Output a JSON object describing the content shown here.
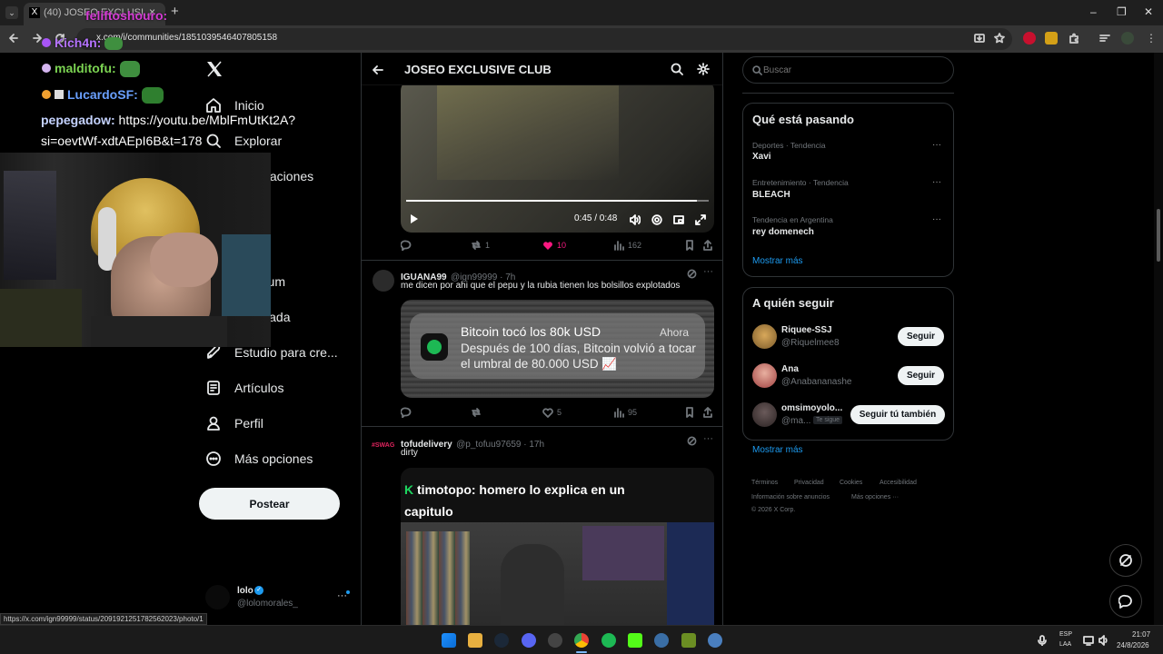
{
  "browser": {
    "tab_title": "(40) JOSEO EXCLUSI...",
    "tab_close": "×",
    "new_tab": "+",
    "url": "x.com/i/communities/1851039546407805158",
    "status_url": "https://x.com/ign99999/status/2091921251782562023/photo/1",
    "window_controls": [
      "–",
      "❐",
      "✕"
    ]
  },
  "sidebar": {
    "items": [
      {
        "label": "Inicio",
        "icon": "home-icon"
      },
      {
        "label": "Explorar",
        "icon": "search-icon"
      },
      {
        "label": "Notificaciones",
        "icon": "bell-icon"
      },
      {
        "label": "Premium",
        "icon": "x-icon"
      },
      {
        "label": "Verificada",
        "icon": "lightning-icon"
      },
      {
        "label": "Estudio para cre...",
        "icon": "rocket-icon"
      },
      {
        "label": "Artículos",
        "icon": "article-icon"
      },
      {
        "label": "Perfil",
        "icon": "person-icon"
      },
      {
        "label": "Más opciones",
        "icon": "more-circle-icon"
      }
    ],
    "post_button": "Postear",
    "account": {
      "name": "lolo",
      "handle": "@lolomorales_"
    }
  },
  "main": {
    "header_title": "JOSEO EXCLUSIVE CLUB",
    "video": {
      "time": "0:45 / 0:48",
      "progress": 0.96
    },
    "tweet1_actions": {
      "replies": "",
      "reposts": "1",
      "likes": "10",
      "views": "162"
    },
    "tweet2": {
      "name": "IGUANA99",
      "handle": "@ign99999 · 7h",
      "text": "me dicen por ahi que el pepu y la rubia tienen los bolsillos explotados",
      "notif_title": "Bitcoin tocó los 80k USD",
      "notif_time": "Ahora",
      "notif_body": "Después de 100 días, Bitcoin volvió a tocar el umbral de 80.000 USD 📈",
      "actions": {
        "replies": "",
        "reposts": "",
        "likes": "5",
        "views": "95"
      }
    },
    "tweet3": {
      "name": "tofudelivery",
      "handle": "@p_tofuu97659 · 17h",
      "badge": "#SWAG",
      "text": "dirty",
      "overlay_user": "timotopo",
      "overlay_text": ": homero lo explica en un capitulo"
    }
  },
  "right": {
    "search_placeholder": "Buscar",
    "trending": {
      "title": "Qué está pasando",
      "items": [
        {
          "meta": "Deportes · Tendencia",
          "name": "Xavi"
        },
        {
          "meta": "Entretenimiento · Tendencia",
          "name": "BLEACH"
        },
        {
          "meta": "Tendencia en Argentina",
          "name": "rey domenech"
        }
      ],
      "show_more": "Mostrar más"
    },
    "who_to_follow": {
      "title": "A quién seguir",
      "users": [
        {
          "name": "Riquee-SSJ",
          "handle": "@Riquelmee8",
          "button": "Seguir"
        },
        {
          "name": "Ana",
          "handle": "@Anabananashe",
          "button": "Seguir"
        },
        {
          "name": "omsimoyolo...",
          "handle": "@ma...",
          "follows_you": "Te sigue",
          "button": "Seguir tú también"
        }
      ],
      "show_more": "Mostrar más"
    },
    "footer": {
      "line1": [
        "Términos",
        "Privacidad",
        "Cookies",
        "Accesibilidad"
      ],
      "line2": [
        "Información sobre anuncios",
        "Más opciones ···"
      ],
      "copyright": "© 2026 X Corp."
    }
  },
  "stream_chat": [
    {
      "user": "Kich4n:",
      "text": ""
    },
    {
      "user": "malditofu:",
      "text": ""
    },
    {
      "user": "LucardoSF:",
      "text": ""
    },
    {
      "user": "pepegadow:",
      "text": " https://youtu.be/MblFmUtKt2A?"
    },
    {
      "user": "",
      "text": "si=oevtWf-xdtAEpI6B&t=178"
    },
    {
      "user": "feliftoshouro:",
      "text": ""
    }
  ],
  "taskbar": {
    "lang": "ESP",
    "lang2": "LAA",
    "time": "21:07",
    "date": "24/8/2026"
  },
  "colors": {
    "like": "#f91880",
    "link": "#1d9bf0",
    "bg": "#000000"
  }
}
